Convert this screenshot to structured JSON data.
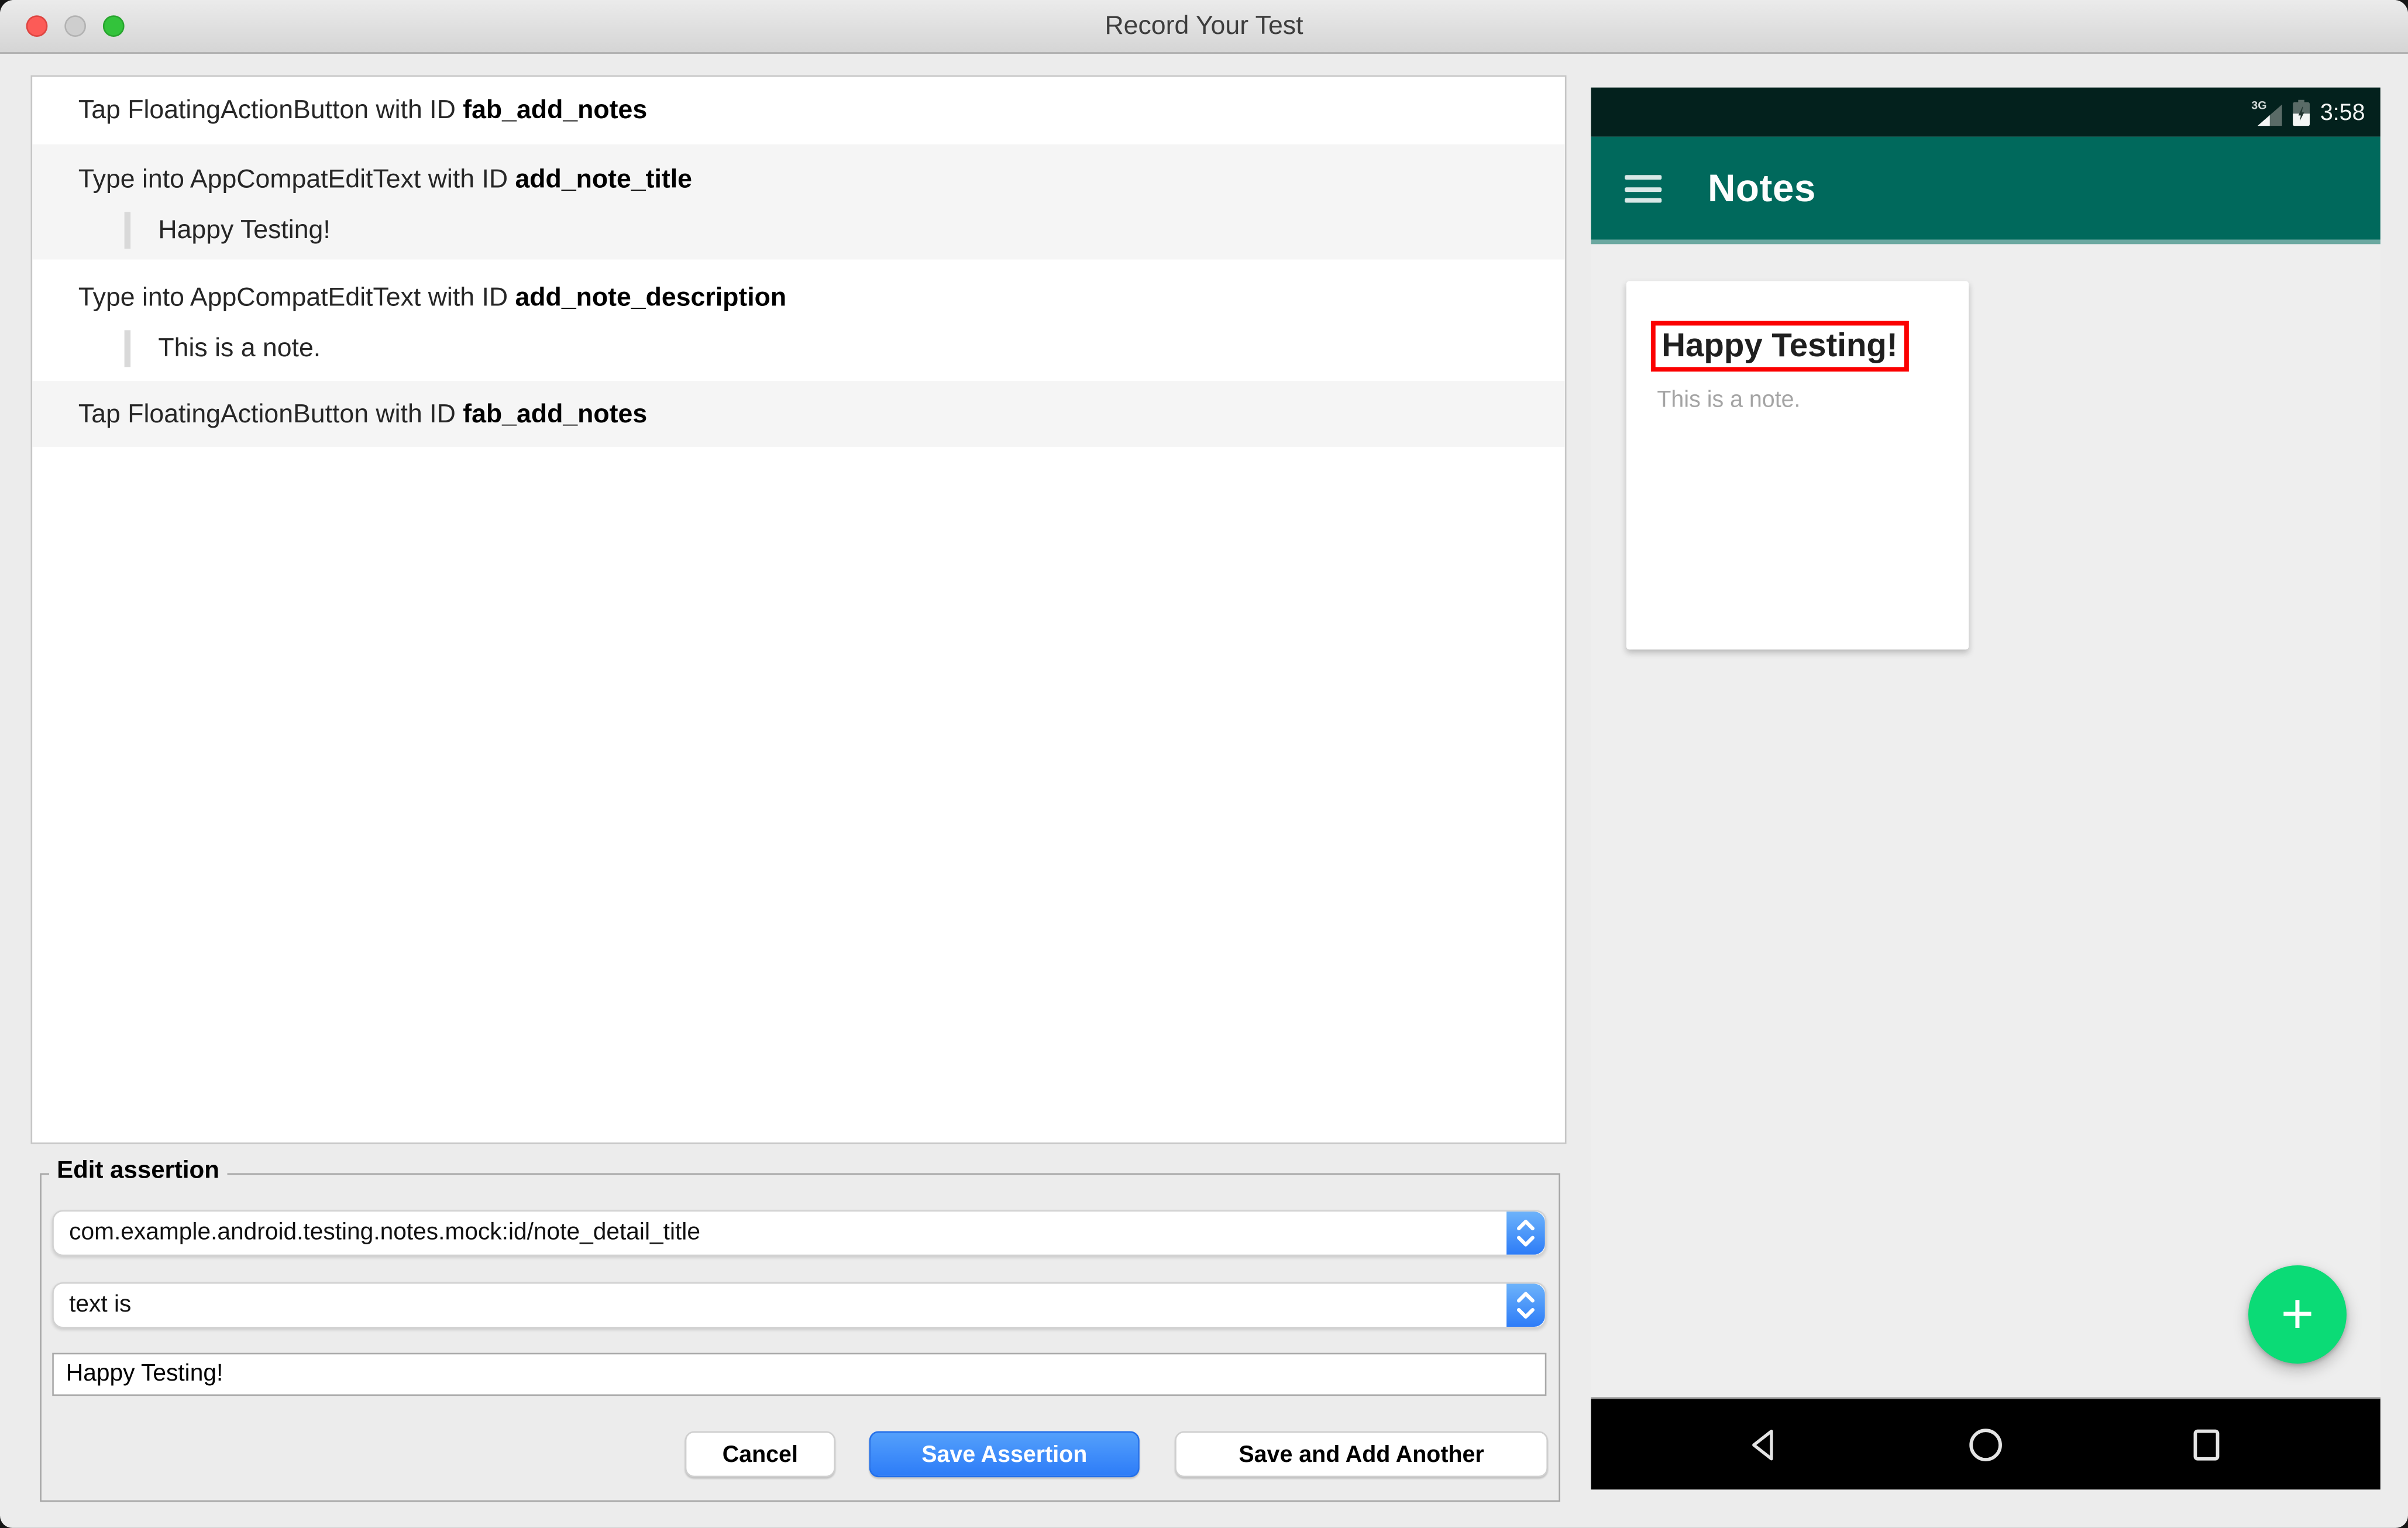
{
  "window": {
    "title": "Record Your Test"
  },
  "actions": [
    {
      "text": "Tap FloatingActionButton with ID ",
      "id": "fab_add_notes"
    },
    {
      "text": "Type into AppCompatEditText with ID ",
      "id": "add_note_title",
      "value": "Happy Testing!"
    },
    {
      "text": "Type into AppCompatEditText with ID ",
      "id": "add_note_description",
      "value": "This is a note."
    },
    {
      "text": "Tap FloatingActionButton with ID ",
      "id": "fab_add_notes"
    }
  ],
  "assertion": {
    "legend": "Edit assertion",
    "view_selector": "com.example.android.testing.notes.mock:id/note_detail_title",
    "condition": "text is",
    "value": "Happy Testing!",
    "cancel_label": "Cancel",
    "save_label": "Save Assertion",
    "save_add_label": "Save and Add Another"
  },
  "device": {
    "status_time": "3:58",
    "network": "3G",
    "app_title": "Notes",
    "note_title": "Happy Testing!",
    "note_description": "This is a note.",
    "fab_glyph": "+"
  },
  "colors": {
    "appbar": "#00695c",
    "statusbar": "#03211d",
    "content-bg": "#eeeeee",
    "fab": "#0bdb76",
    "accent-blue": "#2d7cf8",
    "accent-blue-light": "#6db3fa",
    "highlight-red": "#fb0000",
    "tl-red": "#fc5b57",
    "tl-green": "#33c33b"
  }
}
